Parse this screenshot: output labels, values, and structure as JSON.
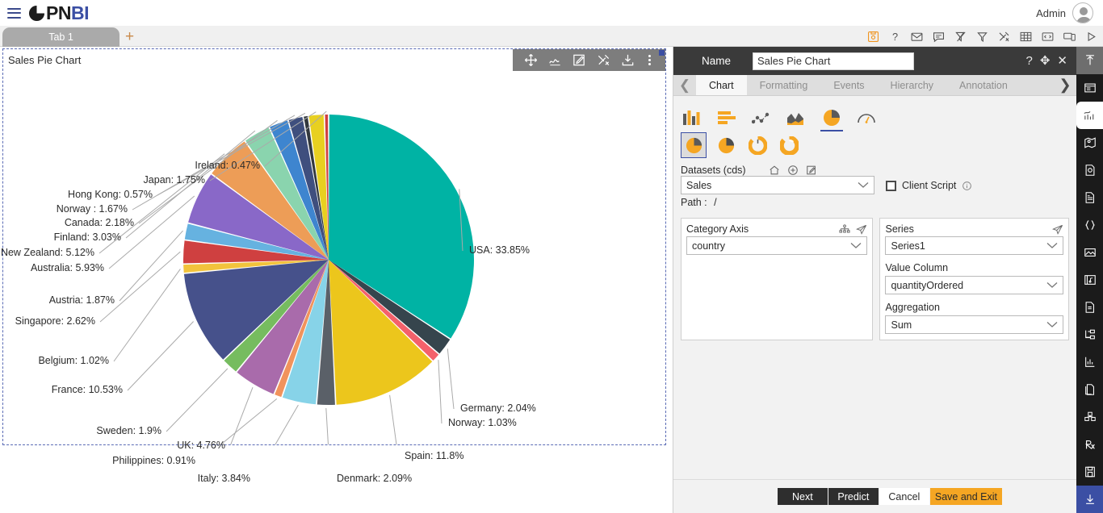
{
  "app": {
    "logo_text_dark": "PN",
    "logo_text_blue": "BI",
    "user_name": "Admin",
    "accent_orange": "#f5a623",
    "accent_blue": "#3b4fa4"
  },
  "tabstrip": {
    "tab_label": "Tab 1",
    "add_label": "+",
    "icons": [
      {
        "name": "save-icon",
        "title": "Save"
      },
      {
        "name": "help-icon",
        "title": "Help"
      },
      {
        "name": "mail-icon",
        "title": "Mail"
      },
      {
        "name": "comment-icon",
        "title": "Comment"
      },
      {
        "name": "clear-filter-icon",
        "title": "Clear Filter"
      },
      {
        "name": "filter-icon",
        "title": "Filter"
      },
      {
        "name": "tools-icon",
        "title": "Tools"
      },
      {
        "name": "table-icon",
        "title": "Table"
      },
      {
        "name": "code-icon",
        "title": "Code"
      },
      {
        "name": "devices-icon",
        "title": "Devices"
      },
      {
        "name": "run-icon",
        "title": "Run"
      }
    ]
  },
  "widget": {
    "title": "Sales Pie Chart",
    "tools": [
      {
        "name": "move-icon",
        "title": "Move"
      },
      {
        "name": "chart-line-icon",
        "title": "Chart"
      },
      {
        "name": "edit-icon",
        "title": "Edit"
      },
      {
        "name": "settings-tools-icon",
        "title": "Settings"
      },
      {
        "name": "download-icon",
        "title": "Download"
      },
      {
        "name": "more-options-icon",
        "title": "More"
      }
    ]
  },
  "chart_data": {
    "type": "pie",
    "title": "Sales Pie Chart",
    "xlabel": "",
    "ylabel": "",
    "value_column": "quantityOrdered",
    "category_column": "country",
    "aggregation": "Sum",
    "label_format": "{name}: {value}%",
    "legend": "none",
    "categories": [
      "USA",
      "Germany",
      "Norway",
      "Spain",
      "Denmark",
      "Italy",
      "Philippines",
      "UK",
      "Sweden",
      "France",
      "Belgium",
      "Singapore",
      "Austria",
      "Australia",
      "New Zealand",
      "Finland",
      "Canada",
      "Norway ",
      "Hong Kong",
      "Japan",
      "Ireland"
    ],
    "values": [
      33.85,
      2.04,
      1.03,
      11.8,
      2.09,
      3.84,
      0.91,
      4.76,
      1.9,
      10.53,
      1.02,
      2.62,
      1.87,
      5.93,
      5.12,
      3.03,
      2.18,
      1.67,
      0.57,
      1.75,
      0.47
    ],
    "colors": [
      "#00b3a4",
      "#36454d",
      "#f4616b",
      "#ecc61c",
      "#5a6068",
      "#87d3e8",
      "#f1935c",
      "#a96bab",
      "#76bc5f",
      "#46518b",
      "#f2c33c",
      "#cf4040",
      "#66b2e0",
      "#8968c8",
      "#ed9d57",
      "#8ad4ae",
      "#3e85cf",
      "#3f4f7e",
      "#32383d",
      "#e8d020",
      "#cf4040"
    ],
    "slices": [
      {
        "label": "USA: 33.85%",
        "name": "USA",
        "value": 33.85,
        "color": "#00b3a4"
      },
      {
        "label": "Germany: 2.04%",
        "name": "Germany",
        "value": 2.04,
        "color": "#36454d"
      },
      {
        "label": "Norway: 1.03%",
        "name": "Norway",
        "value": 1.03,
        "color": "#f4616b"
      },
      {
        "label": "Spain: 11.8%",
        "name": "Spain",
        "value": 11.8,
        "color": "#ecc61c"
      },
      {
        "label": "Denmark: 2.09%",
        "name": "Denmark",
        "value": 2.09,
        "color": "#5a6068"
      },
      {
        "label": "Italy: 3.84%",
        "name": "Italy",
        "value": 3.84,
        "color": "#87d3e8"
      },
      {
        "label": "Philippines: 0.91%",
        "name": "Philippines",
        "value": 0.91,
        "color": "#f1935c"
      },
      {
        "label": "UK: 4.76%",
        "name": "UK",
        "value": 4.76,
        "color": "#a96bab"
      },
      {
        "label": "Sweden: 1.9%",
        "name": "Sweden",
        "value": 1.9,
        "color": "#76bc5f"
      },
      {
        "label": "France: 10.53%",
        "name": "France",
        "value": 10.53,
        "color": "#46518b"
      },
      {
        "label": "Belgium: 1.02%",
        "name": "Belgium",
        "value": 1.02,
        "color": "#f2c33c"
      },
      {
        "label": "Singapore: 2.62%",
        "name": "Singapore",
        "value": 2.62,
        "color": "#cf4040"
      },
      {
        "label": "Austria: 1.87%",
        "name": "Austria",
        "value": 1.87,
        "color": "#66b2e0"
      },
      {
        "label": "Australia: 5.93%",
        "name": "Australia",
        "value": 5.93,
        "color": "#8968c8"
      },
      {
        "label": "New Zealand: 5.12%",
        "name": "New Zealand",
        "value": 5.12,
        "color": "#ed9d57"
      },
      {
        "label": "Finland: 3.03%",
        "name": "Finland",
        "value": 3.03,
        "color": "#8ad4ae"
      },
      {
        "label": "Canada: 2.18%",
        "name": "Canada",
        "value": 2.18,
        "color": "#3e85cf"
      },
      {
        "label": "Norway : 1.67%",
        "name": "Norway ",
        "value": 1.67,
        "color": "#3f4f7e"
      },
      {
        "label": "Hong Kong: 0.57%",
        "name": "Hong Kong",
        "value": 0.57,
        "color": "#32383d"
      },
      {
        "label": "Japan: 1.75%",
        "name": "Japan",
        "value": 1.75,
        "color": "#e8d020"
      },
      {
        "label": "Ireland: 0.47%",
        "name": "Ireland",
        "value": 0.47,
        "color": "#cf4040"
      }
    ]
  },
  "panel": {
    "name_label": "Name",
    "name_value": "Sales Pie Chart",
    "name_placeholder": "Name",
    "header_icons": [
      {
        "name": "help-icon",
        "glyph": "?"
      },
      {
        "name": "move-icon",
        "glyph": "✥"
      },
      {
        "name": "close-icon",
        "glyph": "✕"
      }
    ],
    "tabs": [
      {
        "label": "Chart",
        "active": true
      },
      {
        "label": "Formatting",
        "active": false
      },
      {
        "label": "Events",
        "active": false
      },
      {
        "label": "Hierarchy",
        "active": false
      },
      {
        "label": "Annotation",
        "active": false
      }
    ],
    "chart_types_row1": [
      {
        "name": "column-chart-icon",
        "selected": false
      },
      {
        "name": "bar-chart-icon",
        "selected": false
      },
      {
        "name": "scatter-chart-icon",
        "selected": false
      },
      {
        "name": "area-chart-icon",
        "selected": false
      },
      {
        "name": "pie-chart-icon",
        "selected": true
      },
      {
        "name": "gauge-chart-icon",
        "selected": false
      }
    ],
    "chart_types_row2": [
      {
        "name": "pie-full-icon",
        "selected": true
      },
      {
        "name": "pie-half-icon",
        "selected": false
      },
      {
        "name": "donut-icon",
        "selected": false
      },
      {
        "name": "donut-thick-icon",
        "selected": false
      }
    ],
    "datasets_label": "Datasets (cds)",
    "datasets_value": "Sales",
    "datasets_icons": [
      {
        "name": "home-icon"
      },
      {
        "name": "add-circle-icon"
      },
      {
        "name": "edit-icon"
      }
    ],
    "path_label": "Path :",
    "path_value": "/",
    "client_script_label": "Client Script",
    "client_script_checked": false,
    "category_axis_label": "Category Axis",
    "category_axis_value": "country",
    "category_axis_icons": [
      {
        "name": "hierarchy-icon"
      },
      {
        "name": "send-icon"
      }
    ],
    "series_label": "Series",
    "series_value": "Series1",
    "series_icons": [
      {
        "name": "send-icon"
      }
    ],
    "value_column_label": "Value Column",
    "value_column_value": "quantityOrdered",
    "aggregation_label": "Aggregation",
    "aggregation_value": "Sum",
    "buttons": {
      "next": "Next",
      "predict": "Predict",
      "cancel": "Cancel",
      "save_and_exit": "Save and Exit"
    }
  },
  "rail": {
    "items": [
      {
        "name": "collapse-up-icon",
        "state": "grey"
      },
      {
        "name": "layout-icon",
        "state": "dark"
      },
      {
        "name": "analytics-chart-icon",
        "state": "white"
      },
      {
        "name": "map-icon",
        "state": "dark"
      },
      {
        "name": "image-doc-icon",
        "state": "dark"
      },
      {
        "name": "document-icon",
        "state": "dark"
      },
      {
        "name": "braces-icon",
        "state": "dark"
      },
      {
        "name": "picture-icon",
        "state": "dark"
      },
      {
        "name": "media-icon",
        "state": "dark"
      },
      {
        "name": "file-text-icon",
        "state": "dark"
      },
      {
        "name": "tree-nodes-icon",
        "state": "dark"
      },
      {
        "name": "bar-stats-icon",
        "state": "dark"
      },
      {
        "name": "copy-doc-icon",
        "state": "dark"
      },
      {
        "name": "cubes-icon",
        "state": "dark"
      },
      {
        "name": "prescription-icon",
        "state": "dark"
      },
      {
        "name": "save-doc-icon",
        "state": "dark"
      },
      {
        "name": "download-icon",
        "state": "blue"
      }
    ]
  }
}
